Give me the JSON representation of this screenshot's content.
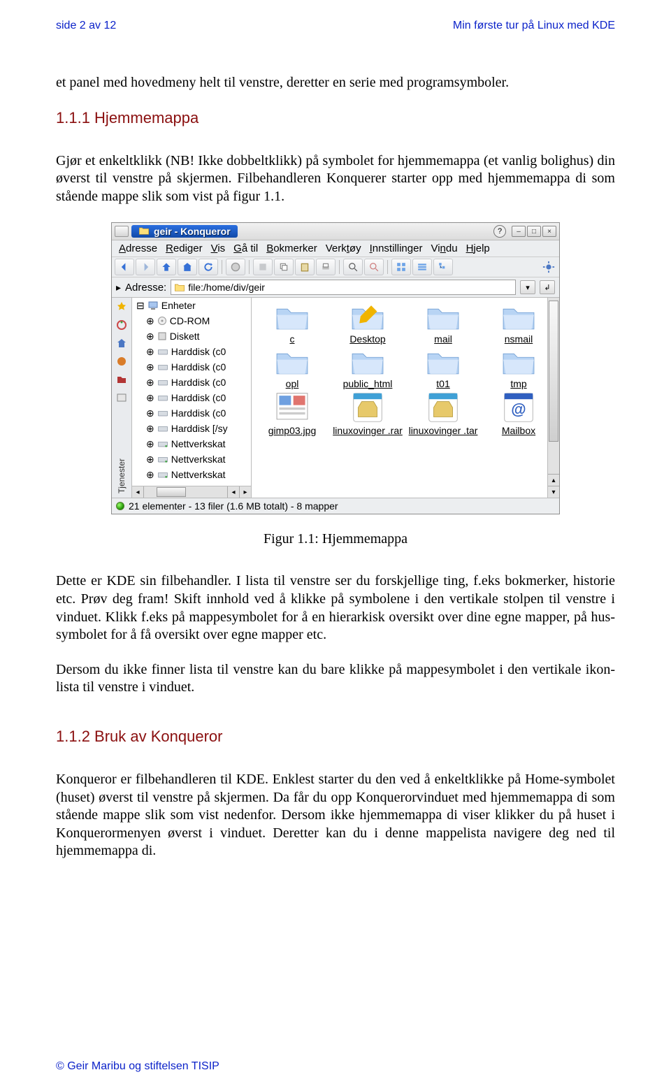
{
  "header": {
    "left": "side 2 av 12",
    "right": "Min første tur på Linux med KDE"
  },
  "p1": "et panel med hovedmeny helt til venstre, deretter en serie med programsymboler.",
  "h1": "1.1.1 Hjemmemappa",
  "p2": "Gjør et enkeltklikk (NB! Ikke dobbeltklikk) på symbolet for hjemmemappa (et vanlig bolighus) din øverst til venstre på skjermen. Filbehandleren Konquerer starter opp med hjemmemappa di som stående mappe slik som vist på figur 1.1.",
  "figcaption": "Figur 1.1: Hjemmemappa",
  "p3": "Dette er KDE sin filbehandler. I lista til venstre ser du forskjellige ting, f.eks bokmerker, historie etc. Prøv deg fram! Skift innhold ved å klikke på symbolene i den vertikale stolpen til venstre i vinduet. Klikk f.eks på mappesymbolet for å en hierarkisk oversikt over dine egne mapper, på hus-symbolet for å få oversikt over egne mapper etc.",
  "p4": "Dersom du ikke finner lista til venstre kan du bare klikke på mappesymbolet i den vertikale ikon-lista til venstre i vinduet.",
  "h2": "1.1.2 Bruk av Konqueror",
  "p5": "Konqueror er filbehandleren til KDE. Enklest starter du den ved å enkeltklikke på Home-symbolet (huset) øverst til venstre på skjermen. Da får du opp Konquerorvinduet med hjemmemappa di som stående mappe slik som vist nedenfor. Dersom ikke hjemmemappa di viser klikker du på huset i Konquerormenyen øverst i vinduet. Deretter kan du i denne mappelista navigere deg ned til hjemmemappa di.",
  "footer": "© Geir Maribu og stiftelsen TISIP",
  "konq": {
    "title": "geir - Konqueror",
    "menus": [
      "Adresse",
      "Rediger",
      "Vis",
      "Gå til",
      "Bokmerker",
      "Verktøy",
      "Innstillinger",
      "Vindu",
      "Hjelp"
    ],
    "address_label": "Adresse:",
    "address_value": "file:/home/div/geir",
    "sidebar_label": "Tjenester",
    "tree": {
      "root": "Enheter",
      "items": [
        "CD-ROM",
        "Diskett",
        "Harddisk (c0",
        "Harddisk (c0",
        "Harddisk (c0",
        "Harddisk (c0",
        "Harddisk (c0",
        "Harddisk [/sy",
        "Nettverkskat",
        "Nettverkskat",
        "Nettverkskat"
      ]
    },
    "icons": [
      {
        "label": "c",
        "type": "folder"
      },
      {
        "label": "Desktop",
        "type": "folder-edit"
      },
      {
        "label": "mail",
        "type": "folder"
      },
      {
        "label": "nsmail",
        "type": "folder"
      },
      {
        "label": "opl",
        "type": "folder"
      },
      {
        "label": "public_html",
        "type": "folder"
      },
      {
        "label": "t01",
        "type": "folder"
      },
      {
        "label": "tmp",
        "type": "folder"
      },
      {
        "label": "gimp03.jpg",
        "type": "thumb"
      },
      {
        "label": "linuxovinger .rar",
        "type": "archive"
      },
      {
        "label": "linuxovinger .tar",
        "type": "archive"
      },
      {
        "label": "Mailbox",
        "type": "mail"
      }
    ],
    "status": "21 elementer -  13 filer (1.6 MB totalt) - 8 mapper"
  }
}
